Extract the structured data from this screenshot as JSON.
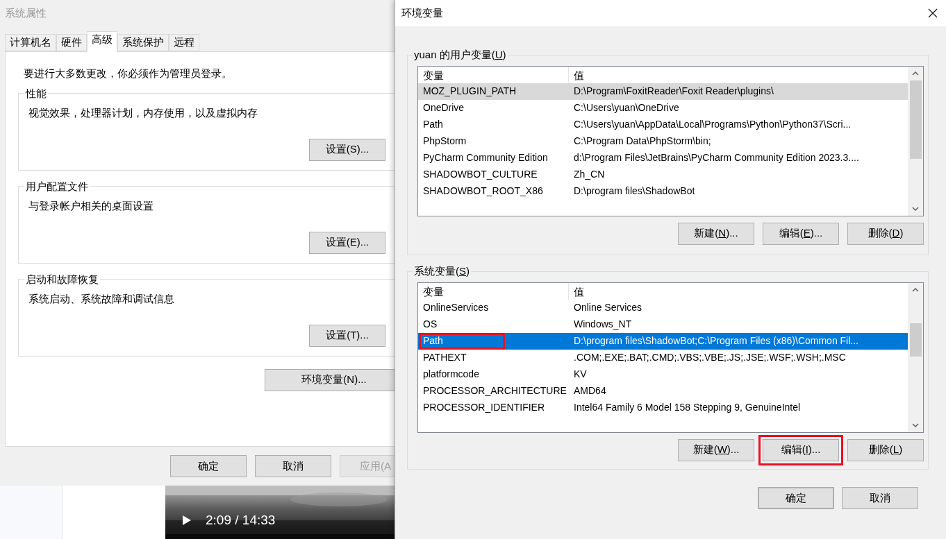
{
  "system_properties": {
    "title": "系统属性",
    "active": false,
    "tabs": [
      {
        "label": "计算机名",
        "selected": false
      },
      {
        "label": "硬件",
        "selected": false
      },
      {
        "label": "高级",
        "selected": true
      },
      {
        "label": "系统保护",
        "selected": false
      },
      {
        "label": "远程",
        "selected": false
      }
    ],
    "notice": "要进行大多数更改，你必须作为管理员登录。",
    "groups": [
      {
        "title": "性能",
        "description": "视觉效果，处理器计划，内存使用，以及虚拟内存",
        "button": "设置(S)..."
      },
      {
        "title": "用户配置文件",
        "description": "与登录帐户相关的桌面设置",
        "button": "设置(E)..."
      },
      {
        "title": "启动和故障恢复",
        "description": "系统启动、系统故障和调试信息",
        "button": "设置(T)..."
      }
    ],
    "env_button": "环境变量(N)...",
    "buttons": [
      {
        "label": "确定",
        "disabled": false
      },
      {
        "label": "取消",
        "disabled": false
      },
      {
        "label": "应用(A",
        "disabled": true
      }
    ]
  },
  "video": {
    "time": "2:09 / 14:33"
  },
  "environment_variables": {
    "title": "环境变量",
    "sections": [
      {
        "title": [
          "yuan 的用户变量(",
          "U",
          ")"
        ],
        "focused": false,
        "columns": [
          "变量",
          "值"
        ],
        "rows": [
          {
            "name": "MOZ_PLUGIN_PATH",
            "value": "D:\\Program\\FoxitReader\\Foxit Reader\\plugins\\",
            "selected": true,
            "highlighted": false
          },
          {
            "name": "OneDrive",
            "value": "C:\\Users\\yuan\\OneDrive",
            "selected": false,
            "highlighted": false
          },
          {
            "name": "Path",
            "value": "C:\\Users\\yuan\\AppData\\Local\\Programs\\Python\\Python37\\Scri...",
            "selected": false,
            "highlighted": false
          },
          {
            "name": "PhpStorm",
            "value": "C:\\Program Data\\PhpStorm\\bin;",
            "selected": false,
            "highlighted": false
          },
          {
            "name": "PyCharm Community Edition",
            "value": "d:\\Program Files\\JetBrains\\PyCharm Community Edition 2023.3....",
            "selected": false,
            "highlighted": false
          },
          {
            "name": "SHADOWBOT_CULTURE",
            "value": "Zh_CN",
            "selected": false,
            "highlighted": false
          },
          {
            "name": "SHADOWBOT_ROOT_X86",
            "value": "D:\\program files\\ShadowBot",
            "selected": false,
            "highlighted": false
          }
        ],
        "buttons": [
          {
            "label": [
              "新建(",
              "N",
              ")..."
            ],
            "highlighted": false
          },
          {
            "label": [
              "编辑(",
              "E",
              ")..."
            ],
            "highlighted": false
          },
          {
            "label": [
              "删除(",
              "D",
              ")"
            ],
            "highlighted": false
          }
        ]
      },
      {
        "title": [
          "系统变量(",
          "S",
          ")"
        ],
        "focused": true,
        "columns": [
          "变量",
          "值"
        ],
        "rows": [
          {
            "name": "OnlineServices",
            "value": "Online Services",
            "selected": false,
            "highlighted": false
          },
          {
            "name": "OS",
            "value": "Windows_NT",
            "selected": false,
            "highlighted": false
          },
          {
            "name": "Path",
            "value": "D:\\program files\\ShadowBot;C:\\Program Files (x86)\\Common Fil...",
            "selected": true,
            "highlighted": true
          },
          {
            "name": "PATHEXT",
            "value": ".COM;.EXE;.BAT;.CMD;.VBS;.VBE;.JS;.JSE;.WSF;.WSH;.MSC",
            "selected": false,
            "highlighted": false
          },
          {
            "name": "platformcode",
            "value": "KV",
            "selected": false,
            "highlighted": false
          },
          {
            "name": "PROCESSOR_ARCHITECTURE",
            "value": "AMD64",
            "selected": false,
            "highlighted": false
          },
          {
            "name": "PROCESSOR_IDENTIFIER",
            "value": "Intel64 Family 6 Model 158 Stepping 9, GenuineIntel",
            "selected": false,
            "highlighted": false
          }
        ],
        "buttons": [
          {
            "label": [
              "新建(",
              "W",
              ")..."
            ],
            "highlighted": false
          },
          {
            "label": [
              "编辑(",
              "I",
              ")..."
            ],
            "highlighted": true
          },
          {
            "label": [
              "删除(",
              "L",
              ")"
            ],
            "highlighted": false
          }
        ]
      }
    ],
    "buttons": [
      {
        "label": "确定",
        "default": true
      },
      {
        "label": "取消",
        "default": false
      }
    ]
  }
}
